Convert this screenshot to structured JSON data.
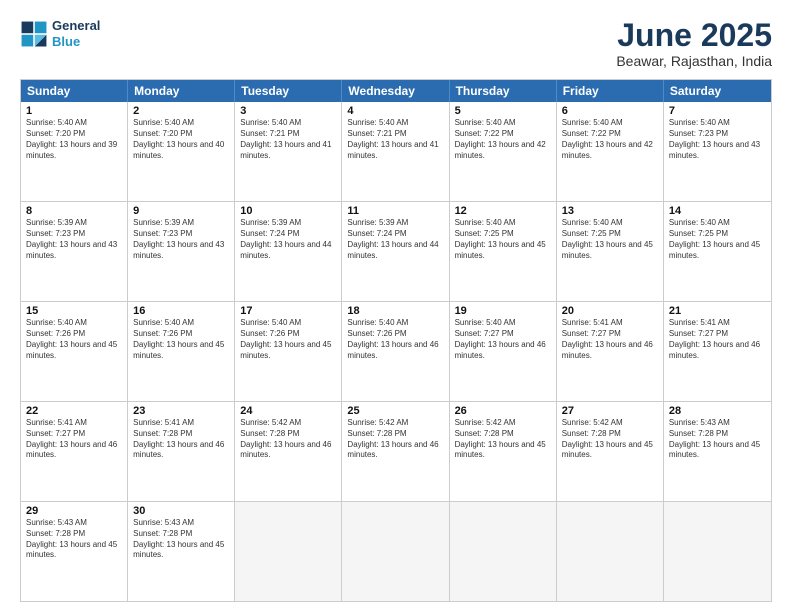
{
  "header": {
    "logo_line1": "General",
    "logo_line2": "Blue",
    "title": "June 2025",
    "subtitle": "Beawar, Rajasthan, India"
  },
  "weekdays": [
    "Sunday",
    "Monday",
    "Tuesday",
    "Wednesday",
    "Thursday",
    "Friday",
    "Saturday"
  ],
  "rows": [
    [
      {
        "day": "",
        "empty": true
      },
      {
        "day": "",
        "empty": true
      },
      {
        "day": "",
        "empty": true
      },
      {
        "day": "",
        "empty": true
      },
      {
        "day": "",
        "empty": true
      },
      {
        "day": "",
        "empty": true
      },
      {
        "day": "",
        "empty": true
      }
    ],
    [
      {
        "day": "1",
        "sunrise": "Sunrise: 5:40 AM",
        "sunset": "Sunset: 7:20 PM",
        "daylight": "Daylight: 13 hours and 39 minutes."
      },
      {
        "day": "2",
        "sunrise": "Sunrise: 5:40 AM",
        "sunset": "Sunset: 7:20 PM",
        "daylight": "Daylight: 13 hours and 40 minutes."
      },
      {
        "day": "3",
        "sunrise": "Sunrise: 5:40 AM",
        "sunset": "Sunset: 7:21 PM",
        "daylight": "Daylight: 13 hours and 41 minutes."
      },
      {
        "day": "4",
        "sunrise": "Sunrise: 5:40 AM",
        "sunset": "Sunset: 7:21 PM",
        "daylight": "Daylight: 13 hours and 41 minutes."
      },
      {
        "day": "5",
        "sunrise": "Sunrise: 5:40 AM",
        "sunset": "Sunset: 7:22 PM",
        "daylight": "Daylight: 13 hours and 42 minutes."
      },
      {
        "day": "6",
        "sunrise": "Sunrise: 5:40 AM",
        "sunset": "Sunset: 7:22 PM",
        "daylight": "Daylight: 13 hours and 42 minutes."
      },
      {
        "day": "7",
        "sunrise": "Sunrise: 5:40 AM",
        "sunset": "Sunset: 7:23 PM",
        "daylight": "Daylight: 13 hours and 43 minutes."
      }
    ],
    [
      {
        "day": "8",
        "sunrise": "Sunrise: 5:39 AM",
        "sunset": "Sunset: 7:23 PM",
        "daylight": "Daylight: 13 hours and 43 minutes."
      },
      {
        "day": "9",
        "sunrise": "Sunrise: 5:39 AM",
        "sunset": "Sunset: 7:23 PM",
        "daylight": "Daylight: 13 hours and 43 minutes."
      },
      {
        "day": "10",
        "sunrise": "Sunrise: 5:39 AM",
        "sunset": "Sunset: 7:24 PM",
        "daylight": "Daylight: 13 hours and 44 minutes."
      },
      {
        "day": "11",
        "sunrise": "Sunrise: 5:39 AM",
        "sunset": "Sunset: 7:24 PM",
        "daylight": "Daylight: 13 hours and 44 minutes."
      },
      {
        "day": "12",
        "sunrise": "Sunrise: 5:40 AM",
        "sunset": "Sunset: 7:25 PM",
        "daylight": "Daylight: 13 hours and 45 minutes."
      },
      {
        "day": "13",
        "sunrise": "Sunrise: 5:40 AM",
        "sunset": "Sunset: 7:25 PM",
        "daylight": "Daylight: 13 hours and 45 minutes."
      },
      {
        "day": "14",
        "sunrise": "Sunrise: 5:40 AM",
        "sunset": "Sunset: 7:25 PM",
        "daylight": "Daylight: 13 hours and 45 minutes."
      }
    ],
    [
      {
        "day": "15",
        "sunrise": "Sunrise: 5:40 AM",
        "sunset": "Sunset: 7:26 PM",
        "daylight": "Daylight: 13 hours and 45 minutes."
      },
      {
        "day": "16",
        "sunrise": "Sunrise: 5:40 AM",
        "sunset": "Sunset: 7:26 PM",
        "daylight": "Daylight: 13 hours and 45 minutes."
      },
      {
        "day": "17",
        "sunrise": "Sunrise: 5:40 AM",
        "sunset": "Sunset: 7:26 PM",
        "daylight": "Daylight: 13 hours and 45 minutes."
      },
      {
        "day": "18",
        "sunrise": "Sunrise: 5:40 AM",
        "sunset": "Sunset: 7:26 PM",
        "daylight": "Daylight: 13 hours and 46 minutes."
      },
      {
        "day": "19",
        "sunrise": "Sunrise: 5:40 AM",
        "sunset": "Sunset: 7:27 PM",
        "daylight": "Daylight: 13 hours and 46 minutes."
      },
      {
        "day": "20",
        "sunrise": "Sunrise: 5:41 AM",
        "sunset": "Sunset: 7:27 PM",
        "daylight": "Daylight: 13 hours and 46 minutes."
      },
      {
        "day": "21",
        "sunrise": "Sunrise: 5:41 AM",
        "sunset": "Sunset: 7:27 PM",
        "daylight": "Daylight: 13 hours and 46 minutes."
      }
    ],
    [
      {
        "day": "22",
        "sunrise": "Sunrise: 5:41 AM",
        "sunset": "Sunset: 7:27 PM",
        "daylight": "Daylight: 13 hours and 46 minutes."
      },
      {
        "day": "23",
        "sunrise": "Sunrise: 5:41 AM",
        "sunset": "Sunset: 7:28 PM",
        "daylight": "Daylight: 13 hours and 46 minutes."
      },
      {
        "day": "24",
        "sunrise": "Sunrise: 5:42 AM",
        "sunset": "Sunset: 7:28 PM",
        "daylight": "Daylight: 13 hours and 46 minutes."
      },
      {
        "day": "25",
        "sunrise": "Sunrise: 5:42 AM",
        "sunset": "Sunset: 7:28 PM",
        "daylight": "Daylight: 13 hours and 46 minutes."
      },
      {
        "day": "26",
        "sunrise": "Sunrise: 5:42 AM",
        "sunset": "Sunset: 7:28 PM",
        "daylight": "Daylight: 13 hours and 45 minutes."
      },
      {
        "day": "27",
        "sunrise": "Sunrise: 5:42 AM",
        "sunset": "Sunset: 7:28 PM",
        "daylight": "Daylight: 13 hours and 45 minutes."
      },
      {
        "day": "28",
        "sunrise": "Sunrise: 5:43 AM",
        "sunset": "Sunset: 7:28 PM",
        "daylight": "Daylight: 13 hours and 45 minutes."
      }
    ],
    [
      {
        "day": "29",
        "sunrise": "Sunrise: 5:43 AM",
        "sunset": "Sunset: 7:28 PM",
        "daylight": "Daylight: 13 hours and 45 minutes."
      },
      {
        "day": "30",
        "sunrise": "Sunrise: 5:43 AM",
        "sunset": "Sunset: 7:28 PM",
        "daylight": "Daylight: 13 hours and 45 minutes."
      },
      {
        "day": "",
        "empty": true
      },
      {
        "day": "",
        "empty": true
      },
      {
        "day": "",
        "empty": true
      },
      {
        "day": "",
        "empty": true
      },
      {
        "day": "",
        "empty": true
      }
    ]
  ]
}
